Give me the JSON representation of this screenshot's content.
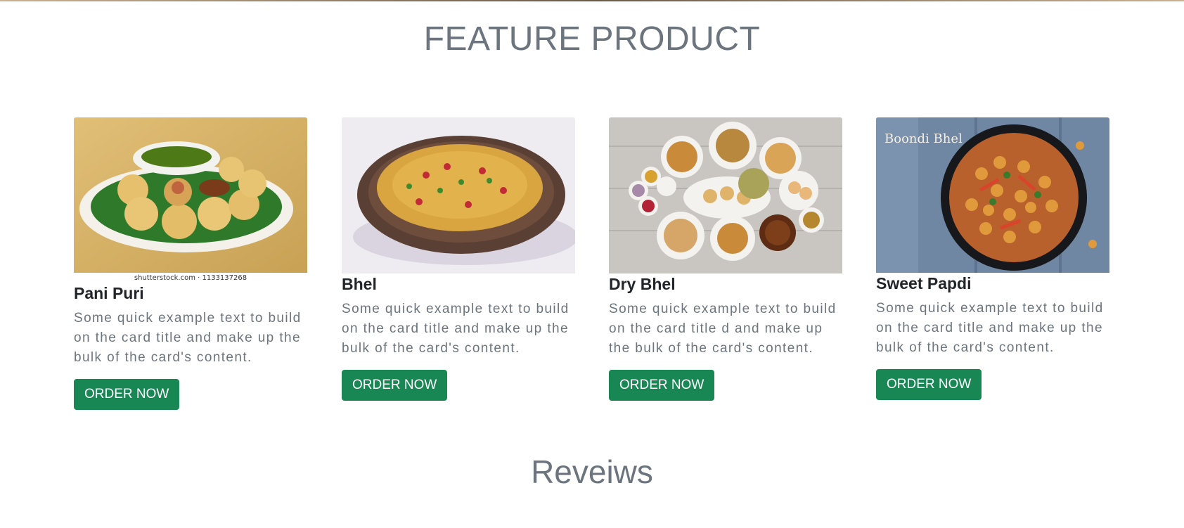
{
  "sections": {
    "feature_title": "FEATURE PRODUCT",
    "reviews_title": "Reveiws"
  },
  "products": [
    {
      "title": "Pani Puri",
      "text": "Some quick example text to build on the card title and make up the bulk of the card's content.",
      "button": "ORDER NOW",
      "image_caption": "shutterstock.com · 1133137268"
    },
    {
      "title": "Bhel",
      "text": "Some quick example text to build on the card title and make up the bulk of the card's content.",
      "button": "ORDER NOW"
    },
    {
      "title": "Dry Bhel",
      "text": "Some quick example text to build on the card title d and make up the bulk of the card's content.",
      "button": "ORDER NOW"
    },
    {
      "title": "Sweet Papdi",
      "text": "Some quick example text to build on the card title and make up the bulk of the card's content.",
      "button": "ORDER NOW",
      "image_caption": "Boondi Bhel"
    }
  ],
  "colors": {
    "button_bg": "#198754",
    "heading_gray": "#6c757d",
    "title_dark": "#212529"
  }
}
